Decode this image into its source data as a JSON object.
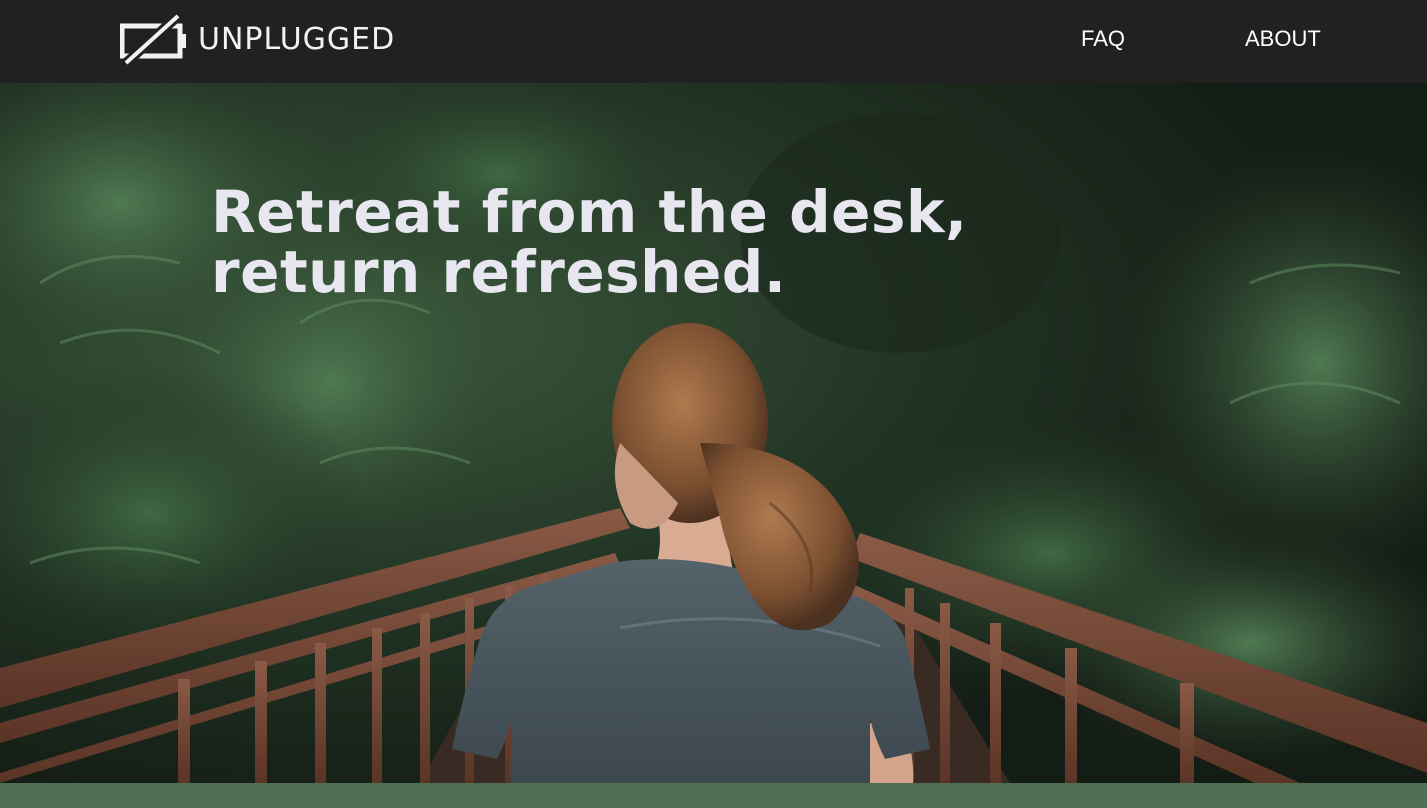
{
  "brand": {
    "name": "UNPLUGGED",
    "logo_icon": "unplugged-battery-icon"
  },
  "nav": {
    "items": [
      {
        "label": "FAQ"
      },
      {
        "label": "ABOUT"
      }
    ]
  },
  "hero": {
    "headline": "Retreat from the desk, return refreshed.",
    "image_icon": "hero-forest-bridge-photo"
  },
  "colors": {
    "topbar": "#212121",
    "accent_strip": "#4f6f52",
    "headline": "#e8e6ef"
  }
}
